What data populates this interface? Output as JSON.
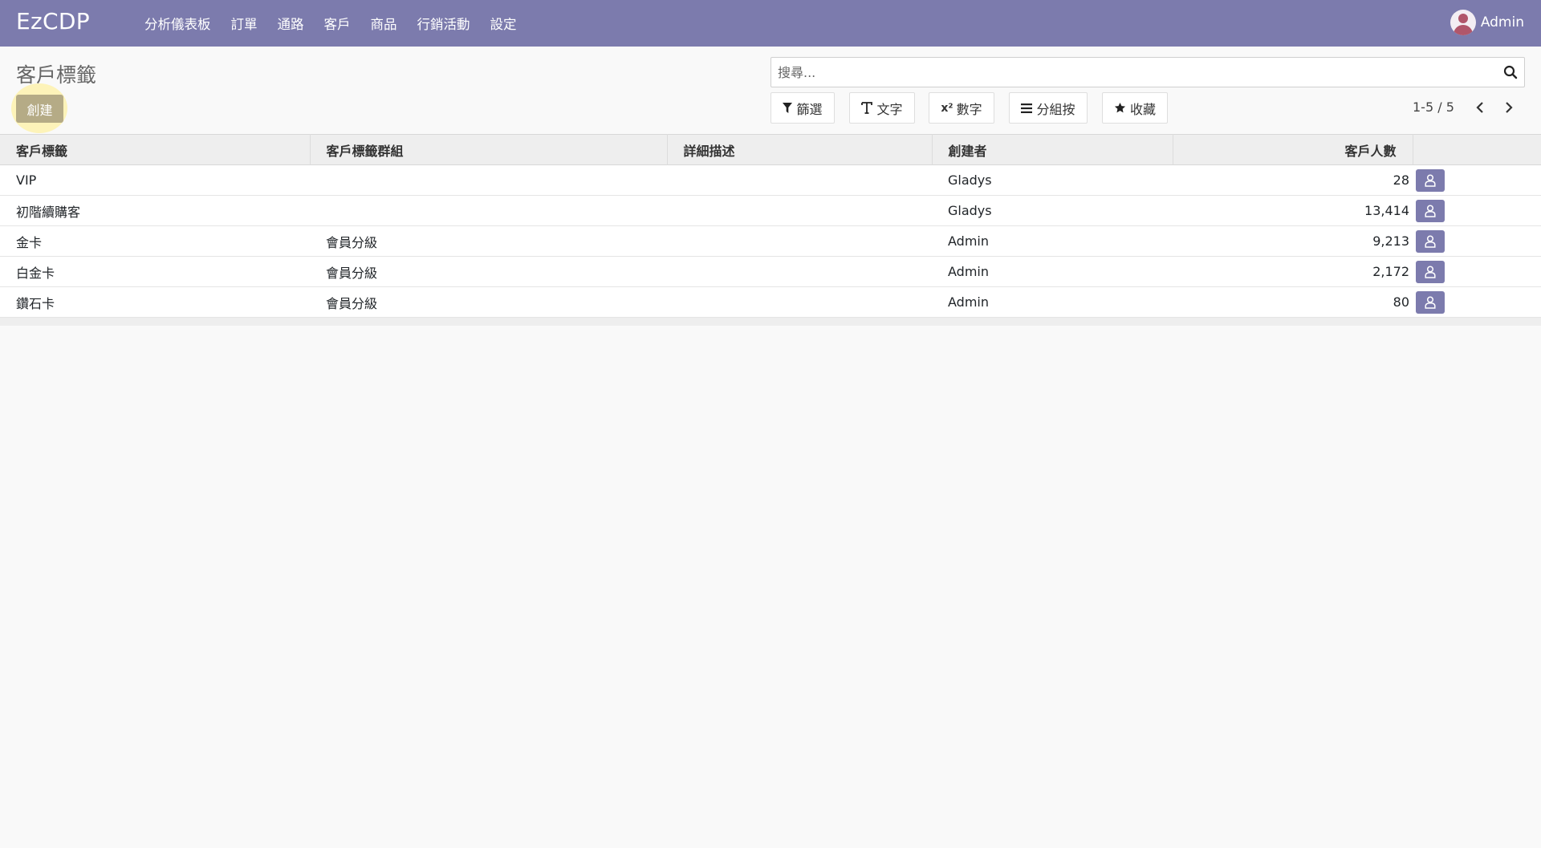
{
  "app": {
    "brand": "EzCDP",
    "menu": [
      "分析儀表板",
      "訂單",
      "通路",
      "客戶",
      "商品",
      "行銷活動",
      "設定"
    ],
    "user": "Admin"
  },
  "page": {
    "title": "客戶標籤",
    "create_label": "創建"
  },
  "search": {
    "placeholder": "搜尋..."
  },
  "toolbar": {
    "filter": "篩選",
    "text": "文字",
    "number": "數字",
    "number_prefix": "x²",
    "group_by": "分組按",
    "favorites": "收藏"
  },
  "pager": {
    "value": "1-5 / 5"
  },
  "table": {
    "columns": [
      "客戶標籤",
      "客戶標籤群組",
      "詳細描述",
      "創建者",
      "客戶人數"
    ],
    "rows": [
      {
        "tag": "VIP",
        "group": "",
        "desc": "",
        "creator": "Gladys",
        "count": "28"
      },
      {
        "tag": "初階續購客",
        "group": "",
        "desc": "",
        "creator": "Gladys",
        "count": "13,414"
      },
      {
        "tag": "金卡",
        "group": "會員分級",
        "desc": "",
        "creator": "Admin",
        "count": "9,213"
      },
      {
        "tag": "白金卡",
        "group": "會員分級",
        "desc": "",
        "creator": "Admin",
        "count": "2,172"
      },
      {
        "tag": "鑽石卡",
        "group": "會員分級",
        "desc": "",
        "creator": "Admin",
        "count": "80"
      }
    ]
  },
  "colors": {
    "topbar": "#7c7bad",
    "create_button": "#b5ab86",
    "row_button": "#7c7bad"
  }
}
